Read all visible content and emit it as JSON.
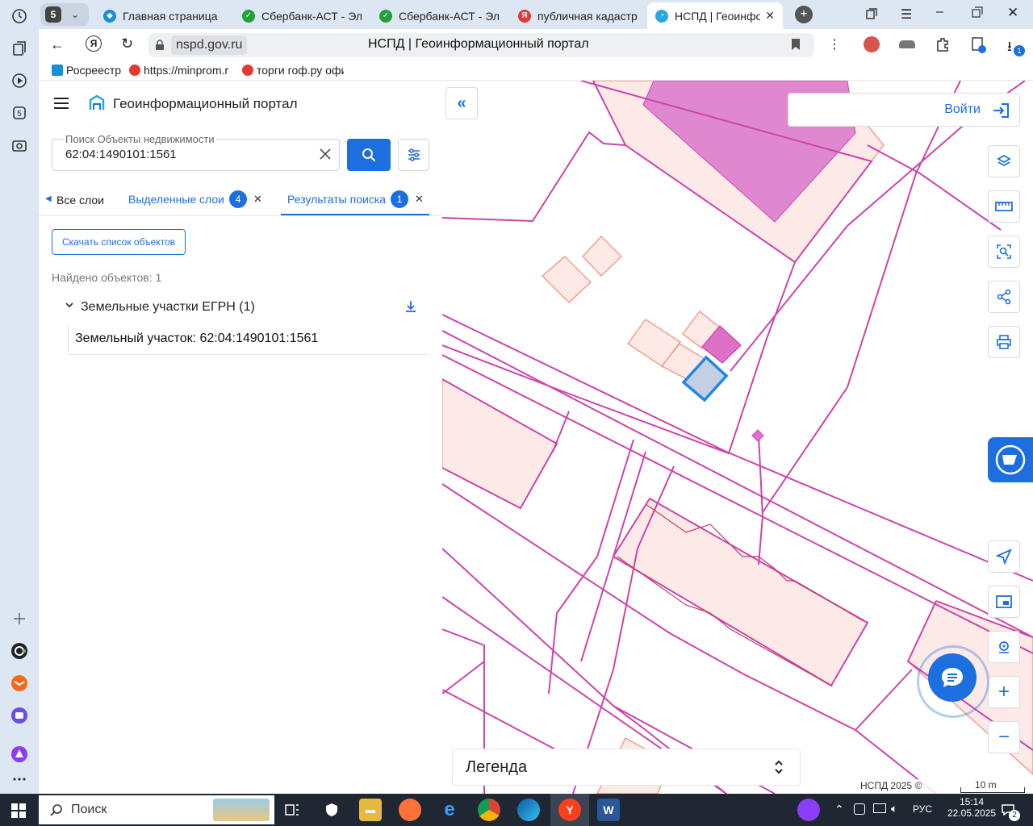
{
  "browser": {
    "tab_count": "5",
    "tabs": [
      {
        "title": "Главная страница"
      },
      {
        "title": "Сбербанк-АСТ - Электронная"
      },
      {
        "title": "Сбербанк-АСТ - Электронная"
      },
      {
        "title": "публичная кадастровая"
      },
      {
        "title": "НСПД | Геоинформационный"
      }
    ],
    "url_host": "nspd.gov.ru",
    "page_title": "НСПД | Геоинформационный портал",
    "downloads_badge": "1",
    "bookmarks": [
      {
        "label": "Росреестр"
      },
      {
        "label": "https://minprom.ru"
      },
      {
        "label": "торги гоф.ру официальный"
      }
    ]
  },
  "app": {
    "title": "Геоинформационный портал",
    "search": {
      "label": "Поиск Объекты недвижимости",
      "value": "62:04:1490101:1561"
    },
    "tabs": [
      {
        "label": "Все слои"
      },
      {
        "label": "Выделенные слои",
        "badge": "4"
      },
      {
        "label": "Результаты поиска",
        "badge": "1"
      }
    ],
    "download_button": "Скачать список объектов",
    "found_text": "Найдено объектов: 1",
    "group_label": "Земельные участки ЕГРН (1)",
    "result_item": "Земельный участок: 62:04:1490101:1561"
  },
  "map": {
    "login_label": "Войти",
    "legend_label": "Легенда",
    "copyright": "НСПД 2025 ©",
    "scale_label": "10 m",
    "colors": {
      "parcel": "#cc44aa",
      "building_fill": "#fde9e6",
      "building_stroke": "#f08c78",
      "selected": "#1e88e5",
      "accent": "#1d6fe0"
    }
  },
  "taskbar": {
    "search_label": "Поиск",
    "lang": "РУС",
    "time": "15:14",
    "date": "22.05.2025",
    "notif_count": "2"
  }
}
